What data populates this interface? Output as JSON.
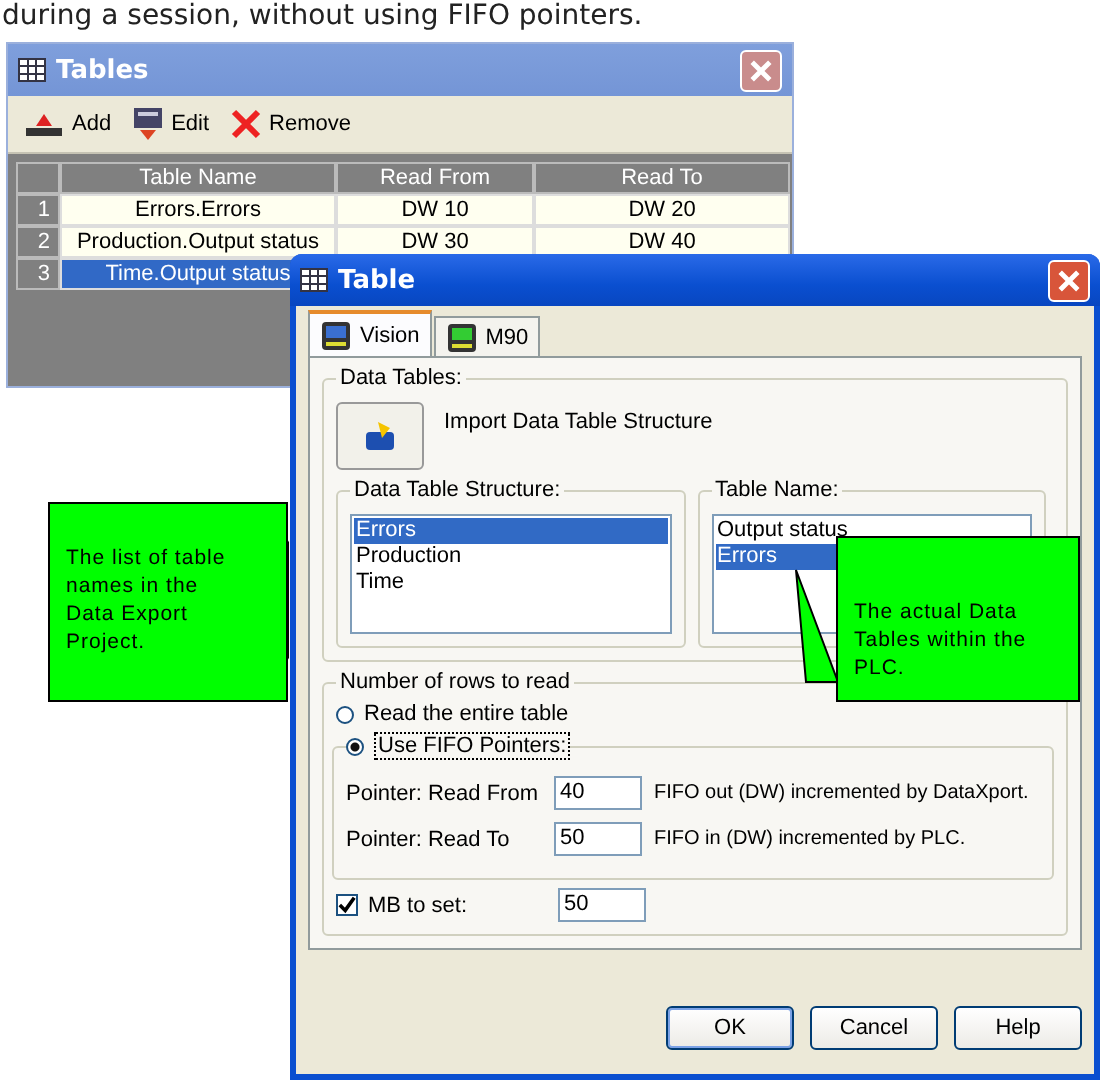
{
  "intro_text": "during a session, without using FIFO pointers.",
  "tables_window": {
    "title": "Tables",
    "toolbar": [
      {
        "label": "Add",
        "kind": "add"
      },
      {
        "label": "Edit",
        "kind": "edit"
      },
      {
        "label": "Remove",
        "kind": "remove"
      }
    ],
    "columns": [
      "Table Name",
      "Read From",
      "Read To"
    ],
    "rows": [
      {
        "index": "1",
        "table_name": "Errors.Errors",
        "read_from": "DW 10",
        "read_to": "DW 20",
        "selected": false
      },
      {
        "index": "2",
        "table_name": "Production.Output status",
        "read_from": "DW 30",
        "read_to": "DW 40",
        "selected": false
      },
      {
        "index": "3",
        "table_name": "Time.Output status",
        "selected": true
      }
    ]
  },
  "table_dialog": {
    "title": "Table",
    "tabs": [
      {
        "label": "Vision",
        "selected": true
      },
      {
        "label": "M90",
        "selected": false
      }
    ],
    "data_tables": {
      "label": "Data Tables:",
      "import_button": "Import Data Table Structure",
      "structure": {
        "label": "Data Table Structure:",
        "items": [
          {
            "label": "Errors",
            "selected": true
          },
          {
            "label": "Production",
            "selected": false
          },
          {
            "label": "Time",
            "selected": false
          }
        ]
      },
      "table_name": {
        "label": "Table Name:",
        "items": [
          {
            "label": "Output status",
            "selected": false
          },
          {
            "label": "Errors",
            "selected": true
          }
        ]
      }
    },
    "rows_to_read": {
      "label": "Number of rows to read",
      "options": [
        {
          "label": "Read the entire table",
          "selected": false
        },
        {
          "label": "Use FIFO Pointers:",
          "selected": true
        }
      ],
      "pointers": [
        {
          "label": "Pointer: Read From",
          "value": "40",
          "note": "FIFO out (DW) incremented by DataXport."
        },
        {
          "label": "Pointer: Read To",
          "value": "50",
          "note": "FIFO in (DW) incremented by PLC."
        }
      ]
    },
    "mb_to_set": {
      "label": "MB to set:",
      "checked": true,
      "value": "50"
    },
    "buttons": [
      "OK",
      "Cancel",
      "Help"
    ]
  },
  "callouts": [
    {
      "text": "The list of table names in the Data Export Project."
    },
    {
      "text": "The actual Data Tables within the PLC."
    }
  ]
}
